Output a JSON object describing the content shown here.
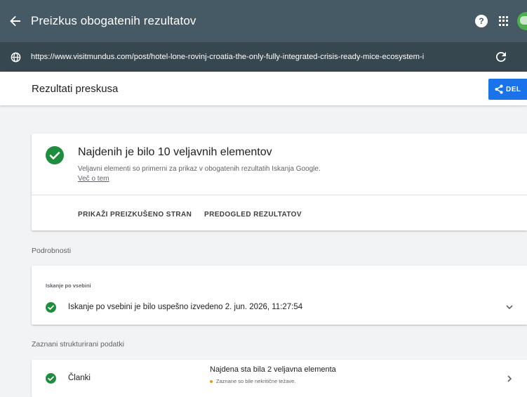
{
  "app": {
    "title": "Preizkus obogatenih rezultatov",
    "help_glyph": "?"
  },
  "urlbar": {
    "url": "https://www.visitmundus.com/post/hotel-lone-rovinj-croatia-the-only-fully-integrated-crisis-ready-mice-ecosystem-i"
  },
  "header": {
    "title": "Rezultati preskusa",
    "share_label": "DEL"
  },
  "summary": {
    "title": "Najdenih je bilo 10 veljavnih elementov",
    "description": "Veljavni elementi so primerni za prikaz v obogatenih rezultatih Iskanja Google.",
    "link": "Več o tem",
    "actions": [
      "PRIKAŽI PREIZKUŠENO STRAN",
      "PREDOGLED REZULTATOV"
    ]
  },
  "details": {
    "section_label": "Podrobnosti",
    "crawl_caption": "Iskanje po vsebini",
    "crawl_status": "Iskanje po vsebini je bilo uspešno izvedeno 2. jun. 2026, 11:27:54"
  },
  "structured": {
    "section_label": "Zaznani strukturirani podatki",
    "items": [
      {
        "label": "Članki",
        "status": "Najdena sta bila 2 veljavna elementa",
        "note": "Zaznane so bile nekritične težave."
      }
    ]
  },
  "colors": {
    "topbar": "#455a64",
    "urlbar": "#37474f",
    "success": "#1e8e3e",
    "accent": "#1a73e8",
    "warning": "#f29900"
  },
  "icons": {
    "back": "arrow-back-icon",
    "help": "help-icon",
    "apps": "apps-grid-icon",
    "globe": "globe-icon",
    "refresh": "refresh-icon",
    "share": "share-icon",
    "success": "check-circle-icon",
    "expand": "chevron-down-icon",
    "open": "chevron-right-icon"
  }
}
